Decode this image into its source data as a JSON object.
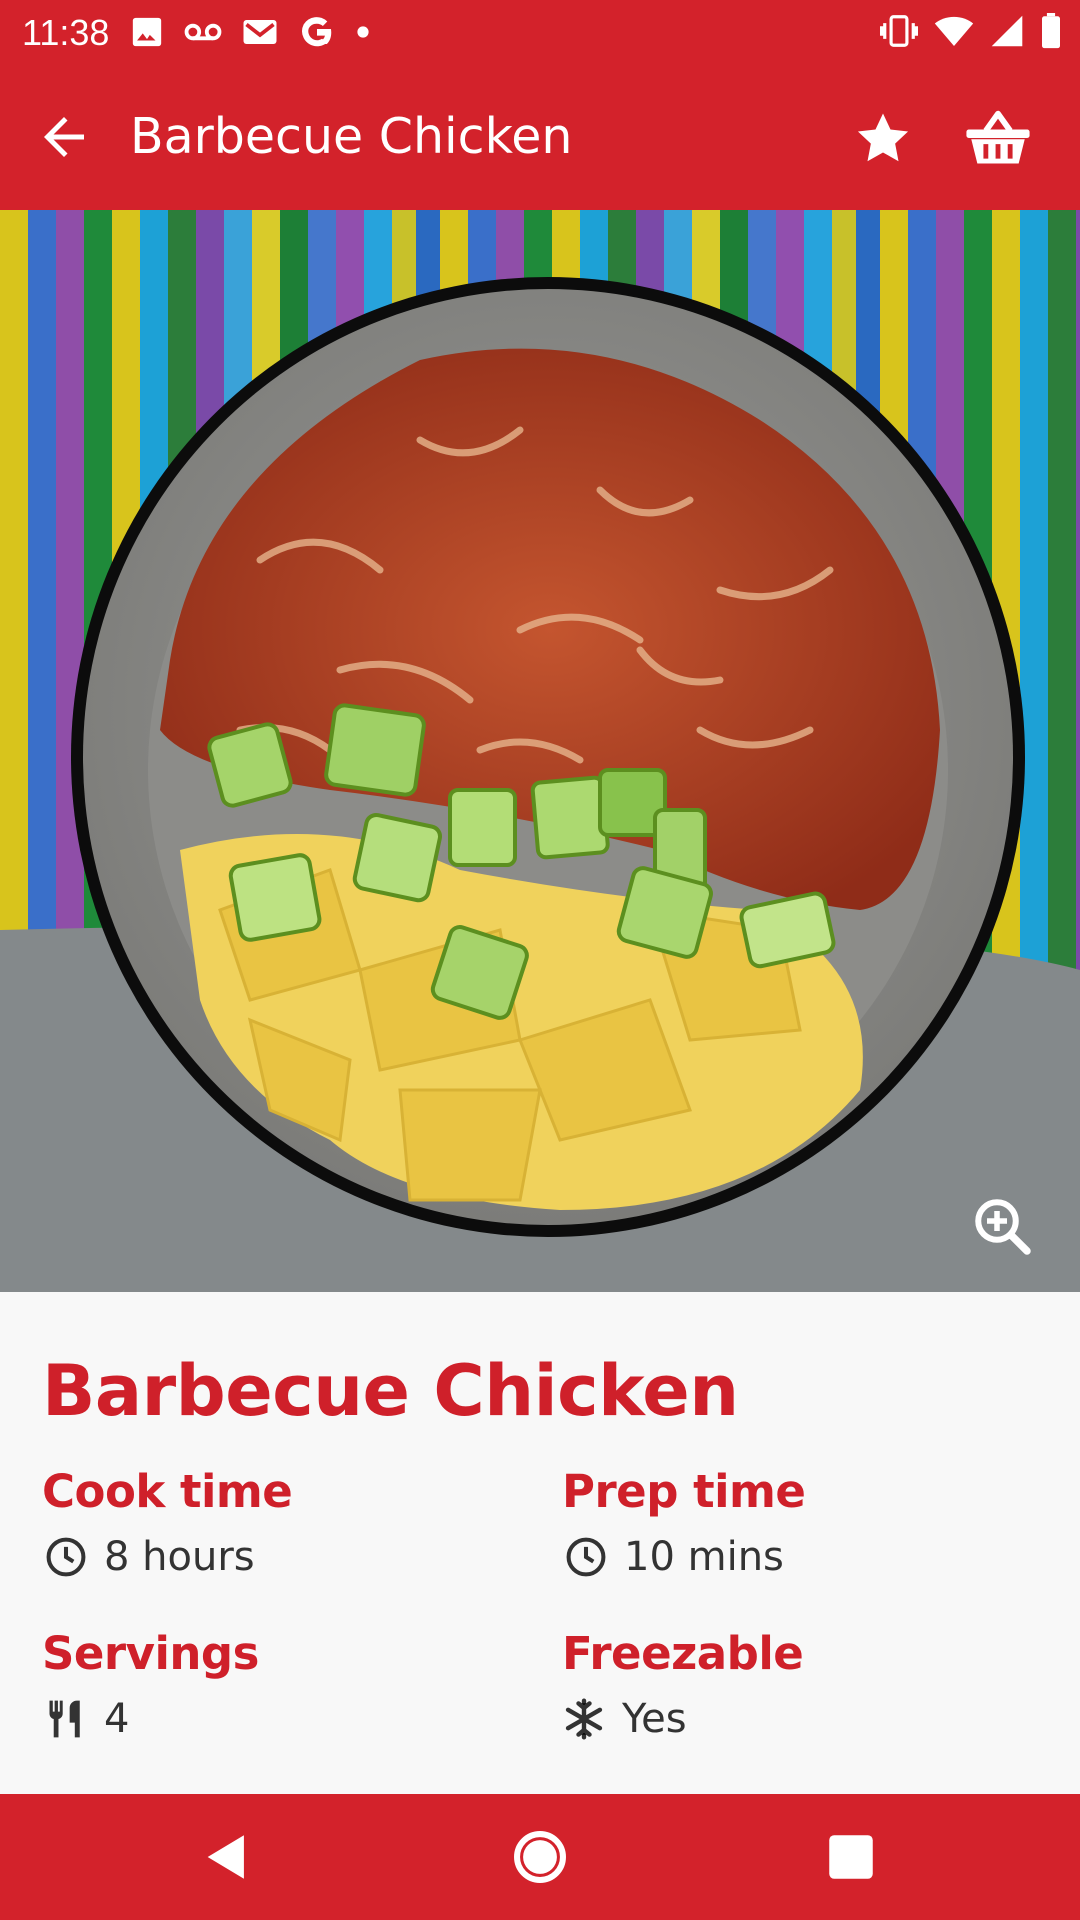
{
  "status_bar": {
    "time": "11:38",
    "left_icons": [
      "image-icon",
      "voicemail-icon",
      "gmail-icon",
      "google-icon",
      "dot-icon"
    ],
    "right_icons": [
      "vibrate-icon",
      "wifi-icon",
      "signal-icon",
      "battery-icon"
    ]
  },
  "app_bar": {
    "title": "Barbecue Chicken",
    "back_icon": "arrow-back-icon",
    "actions": [
      "star-icon",
      "basket-icon"
    ]
  },
  "hero": {
    "zoom_icon": "zoom-in-icon"
  },
  "recipe": {
    "title": "Barbecue Chicken",
    "cook_time_label": "Cook time",
    "cook_time_value": "8 hours",
    "prep_time_label": "Prep time",
    "prep_time_value": "10 mins",
    "servings_label": "Servings",
    "servings_value": "4",
    "freezable_label": "Freezable",
    "freezable_value": "Yes"
  },
  "nav_bar": {
    "buttons": [
      "back-triangle-icon",
      "home-circle-icon",
      "recents-square-icon"
    ]
  },
  "colors": {
    "brand_red": "#d3222b",
    "accent_red_text": "#cf202a",
    "background": "#f8f8f8"
  }
}
